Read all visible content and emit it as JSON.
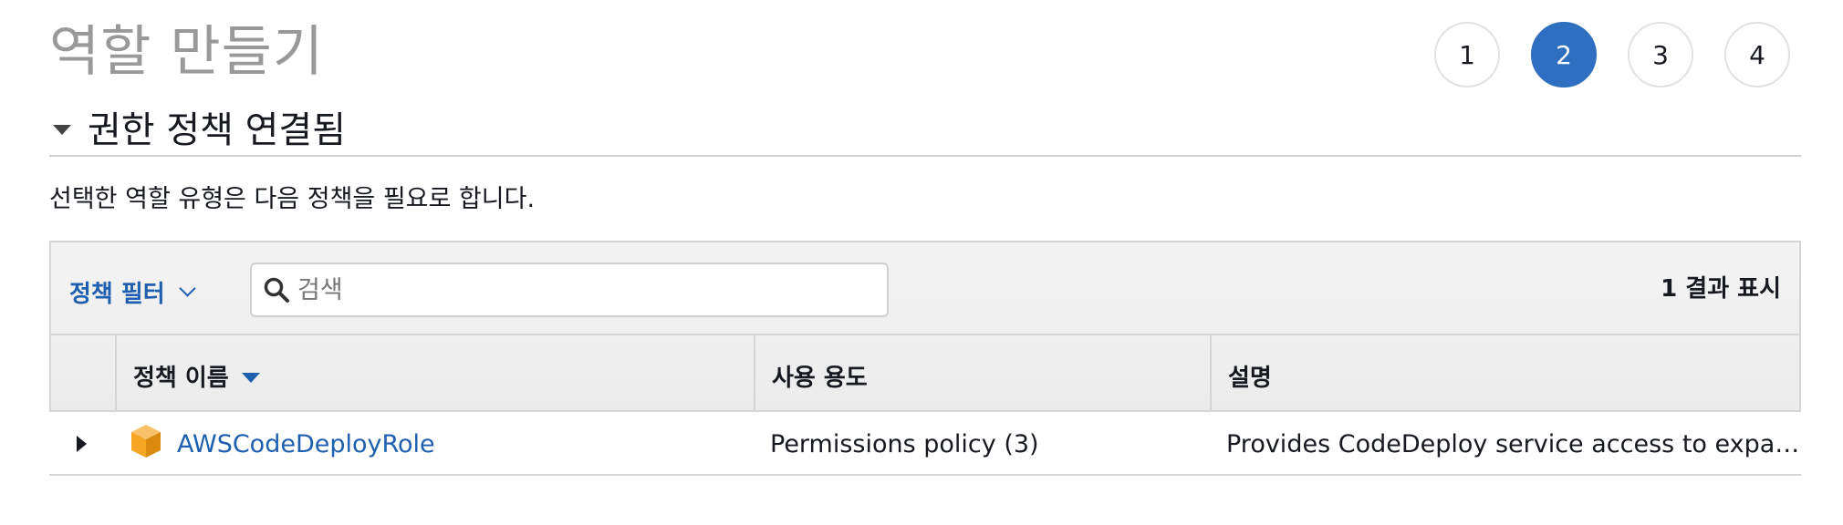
{
  "page": {
    "title": "역할 만들기"
  },
  "steps": [
    {
      "label": "1",
      "active": false
    },
    {
      "label": "2",
      "active": true
    },
    {
      "label": "3",
      "active": false
    },
    {
      "label": "4",
      "active": false
    }
  ],
  "section": {
    "title": "권한 정책 연결됨",
    "description": "선택한 역할 유형은 다음 정책을 필요로 합니다."
  },
  "toolbar": {
    "filter_label": "정책 필터",
    "search_placeholder": "검색",
    "results_text": "1 결과 표시"
  },
  "table": {
    "columns": [
      "정책 이름",
      "사용 용도",
      "설명"
    ],
    "rows": [
      {
        "name": "AWSCodeDeployRole",
        "usage": "Permissions policy (3)",
        "description": "Provides CodeDeploy service access to expa…"
      }
    ]
  },
  "colors": {
    "accent": "#2e6fc1",
    "link": "#1f5fb0",
    "policy_icon": "#f5a623"
  },
  "icons": {
    "search": "search-icon",
    "policy": "policy-cube-icon",
    "expand": "expand-row-icon",
    "sort": "sort-desc-icon"
  }
}
